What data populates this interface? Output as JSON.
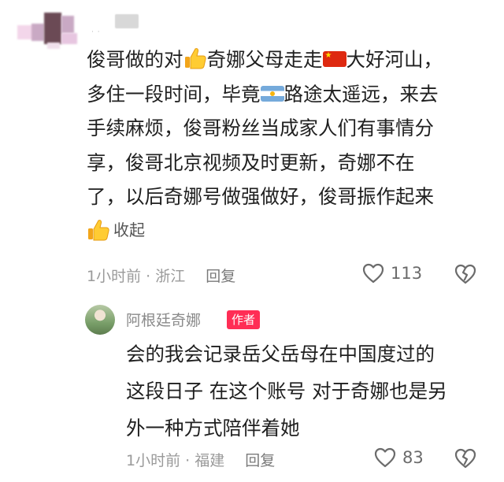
{
  "comment1": {
    "lines": [
      [
        "俊哥做的对",
        "奇娜父母走走",
        "大好河山，"
      ],
      [
        "多住一段时间，毕竟",
        "路途太遥远，来去"
      ],
      [
        "手续麻烦，俊哥粉丝当成家人们有事情分"
      ],
      [
        "享，俊哥北京视频及时更新，奇娜不在"
      ],
      [
        "了，以后奇娜号做强做好，俊哥振作起来"
      ]
    ],
    "collapse_label": "收起",
    "time": "1小时前",
    "location": "浙江",
    "reply_label": "回复",
    "like_count": "113"
  },
  "reply": {
    "author": "阿根廷奇娜",
    "badge": "作者",
    "lines": [
      "会的我会记录岳父岳母在中国度过的",
      "这段日子 在这个账号 对于奇娜也是另",
      "外一种方式陪伴着她"
    ],
    "time": "1小时前",
    "location": "福建",
    "reply_label": "回复",
    "like_count": "83"
  },
  "icons": {
    "thumbs": "thumbs-up-emoji",
    "china_flag": "china-flag-emoji",
    "argentina_flag": "argentina-flag-emoji",
    "heart": "heart-outline-icon",
    "dislike": "broken-heart-icon"
  }
}
